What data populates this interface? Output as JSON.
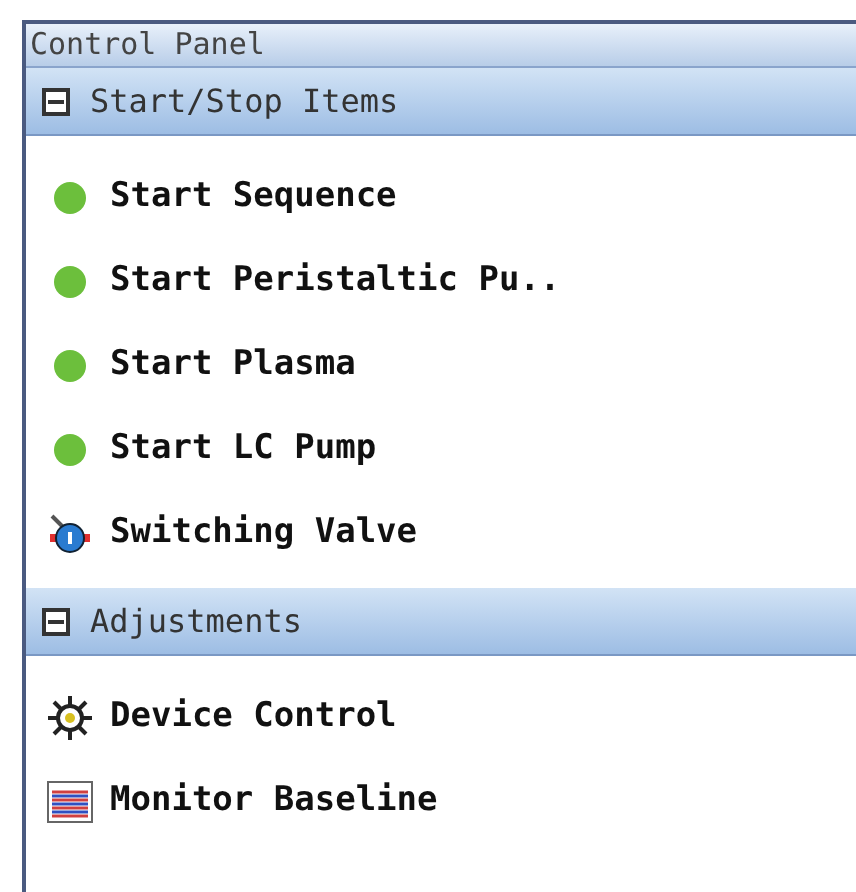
{
  "window": {
    "title": "Control Panel"
  },
  "sections": [
    {
      "title": "Start/Stop Items",
      "expanded": true,
      "items": [
        {
          "kind": "status",
          "label": "Start Sequence",
          "color": "#6cbf3c"
        },
        {
          "kind": "status",
          "label": "Start Peristaltic Pu..",
          "color": "#6cbf3c"
        },
        {
          "kind": "status",
          "label": "Start Plasma",
          "color": "#6cbf3c"
        },
        {
          "kind": "status",
          "label": "Start LC Pump",
          "color": "#6cbf3c"
        },
        {
          "kind": "valve",
          "label": "Switching Valve"
        }
      ]
    },
    {
      "title": "Adjustments",
      "expanded": true,
      "items": [
        {
          "kind": "gear",
          "label": "Device Control"
        },
        {
          "kind": "chart",
          "label": "Monitor Baseline"
        }
      ]
    }
  ]
}
